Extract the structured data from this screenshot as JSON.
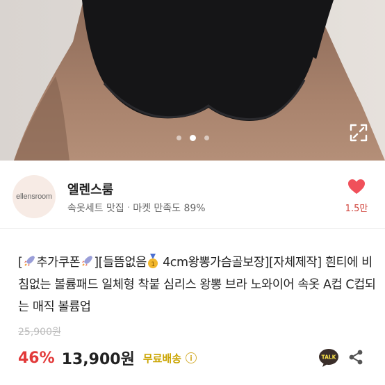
{
  "gallery": {
    "slide_count": 3,
    "active_slide": 2
  },
  "seller": {
    "avatar_text": "ellensroom",
    "name": "엘렌스룸",
    "tag": "속옷세트 맛집",
    "separator": "·",
    "rating_text": "마켓 만족도 89%",
    "like_count": "1.5만"
  },
  "product": {
    "title_prefix_1": "[",
    "title_coupon": "추가쿠폰",
    "title_mid_1": "][들뜸없음",
    "title_mid_2": "4cm왕뽕가슴골보장][자체제작] 흰티에 비침없는 볼륨패드 일체형 착붙 심리스 왕뽕 브라 노와이어 속옷 A컵 C컵되는 매직 볼륨업",
    "original_price": "25,900원",
    "discount": "46%",
    "price": "13,900원",
    "shipping": "무료배송"
  },
  "icons": {
    "expand": "expand-icon",
    "heart": "heart-icon",
    "rocket": "rocket-icon",
    "medal": "medal-icon",
    "info": "info-icon",
    "talk": "kakaotalk-icon",
    "share": "share-icon"
  },
  "colors": {
    "discount": "#e23a3a",
    "shipping": "#caa400",
    "heart": "#f0505a"
  }
}
